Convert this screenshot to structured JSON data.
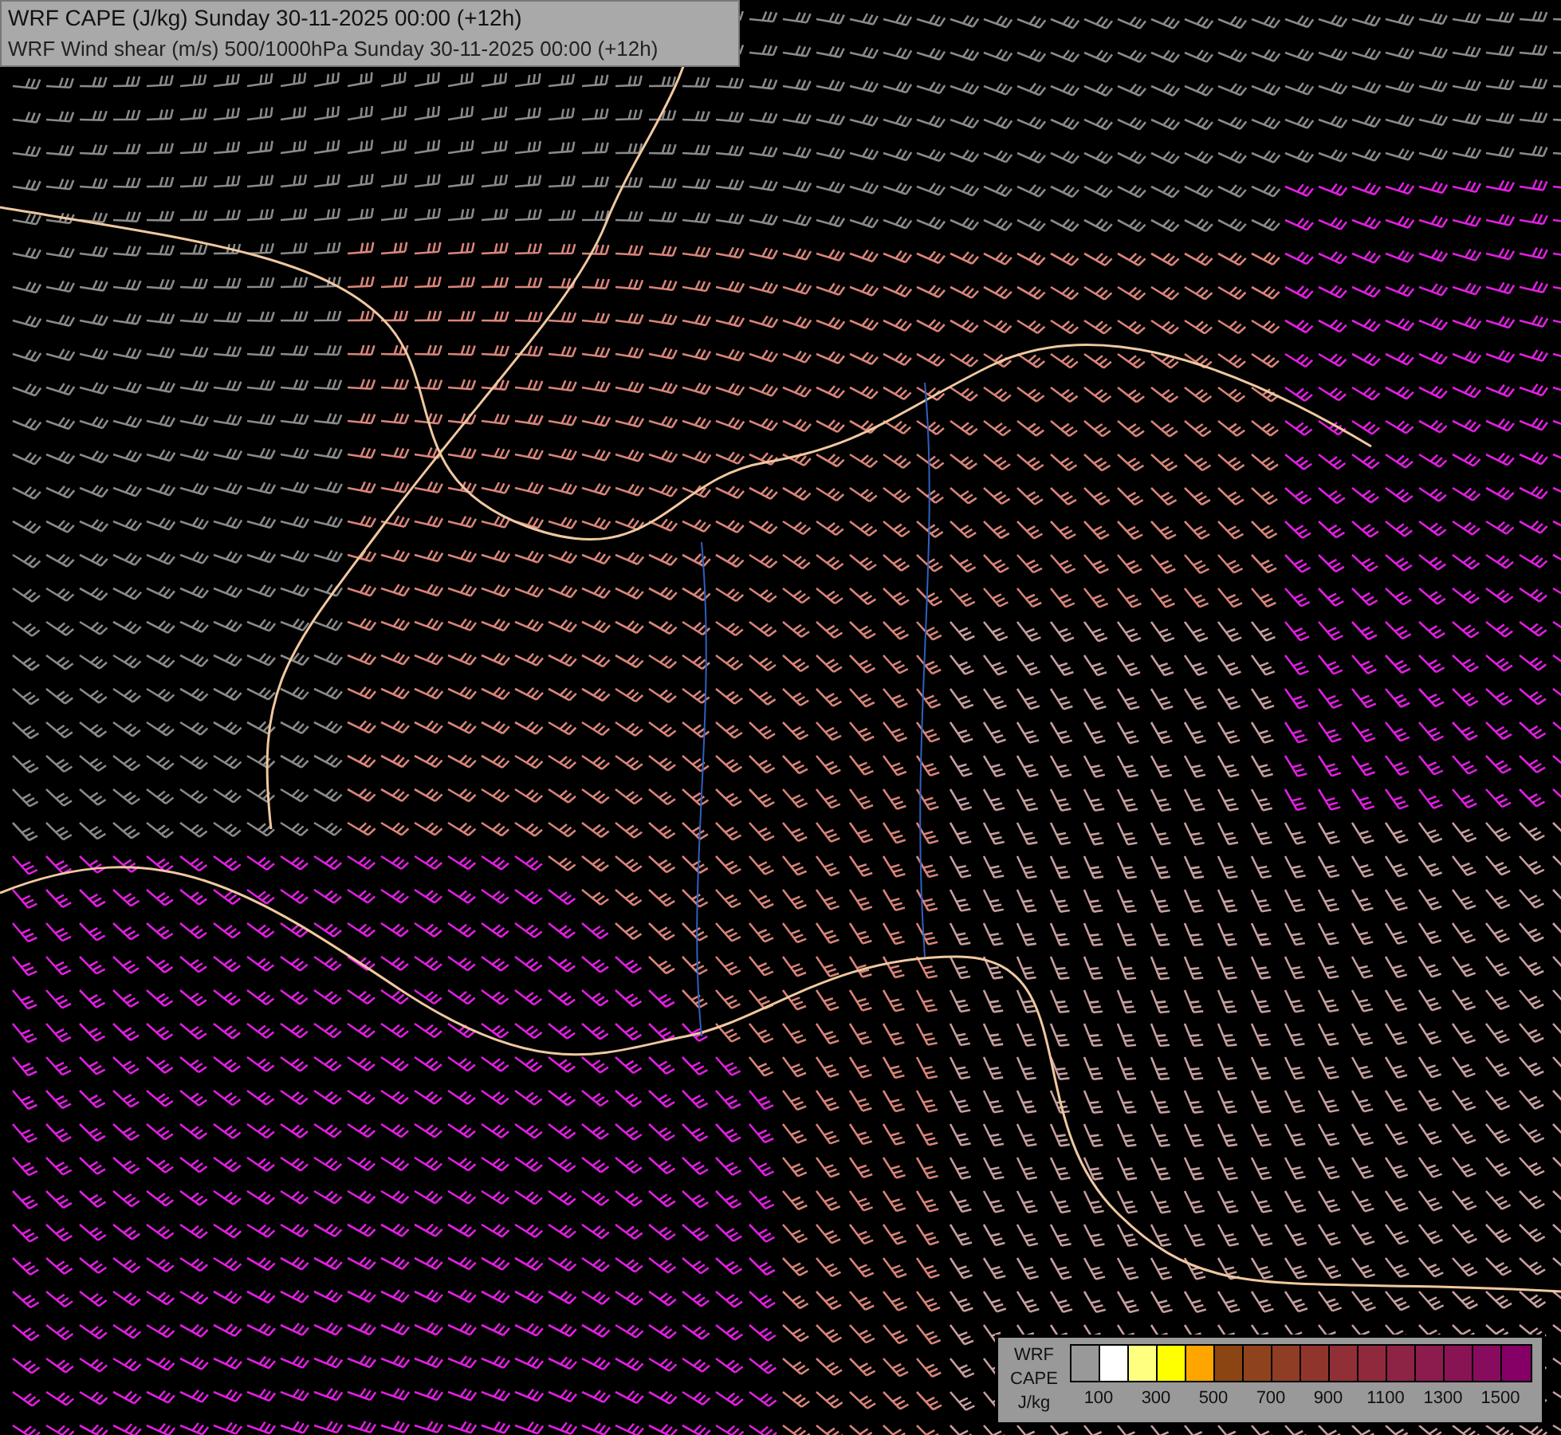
{
  "title_box": {
    "lines": [
      "WRF CAPE (J/kg) Sunday 30-11-2025 00:00 (+12h)",
      "WRF Wind shear (m/s) 500/1000hPa Sunday 30-11-2025 00:00 (+12h)"
    ]
  },
  "legend": {
    "title_lines": [
      "WRF",
      "CAPE",
      "J/kg"
    ],
    "swatches": [
      {
        "color": "#999999"
      },
      {
        "color": "#ffffff"
      },
      {
        "color": "#ffff80"
      },
      {
        "color": "#ffff00"
      },
      {
        "color": "#ffa500"
      },
      {
        "color": "#8b4513"
      },
      {
        "color": "#8e431d"
      },
      {
        "color": "#8f3d25"
      },
      {
        "color": "#90352c"
      },
      {
        "color": "#902f35"
      },
      {
        "color": "#8f2a3d"
      },
      {
        "color": "#8d2345"
      },
      {
        "color": "#8b1c4d"
      },
      {
        "color": "#891455"
      },
      {
        "color": "#870c5e"
      },
      {
        "color": "#850066"
      }
    ],
    "labels": [
      "100",
      "300",
      "500",
      "700",
      "900",
      "1100",
      "1300",
      "1500"
    ]
  }
}
